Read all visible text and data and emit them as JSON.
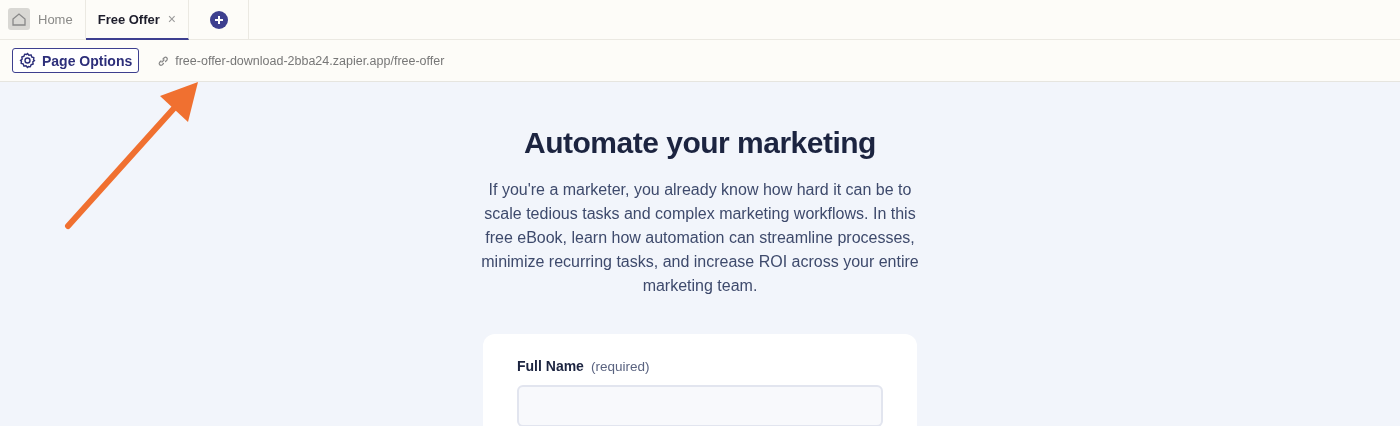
{
  "tabs": [
    {
      "kind": "home",
      "label": "Home",
      "selected": false
    },
    {
      "kind": "page",
      "label": "Free Offer",
      "selected": true,
      "close": "×"
    }
  ],
  "toolbar": {
    "options_button": "Page Options",
    "url": "free-offer-download-2bba24.zapier.app/free-offer"
  },
  "page": {
    "heading": "Automate your marketing",
    "intro": "If you're a marketer, you already know how hard it can be to scale tedious tasks and complex marketing workflows. In this free eBook, learn how automation can streamline processes, minimize recurring tasks, and increase ROI across your entire marketing team."
  },
  "form": {
    "fields": [
      {
        "label": "Full Name",
        "note": "(required)"
      }
    ]
  }
}
